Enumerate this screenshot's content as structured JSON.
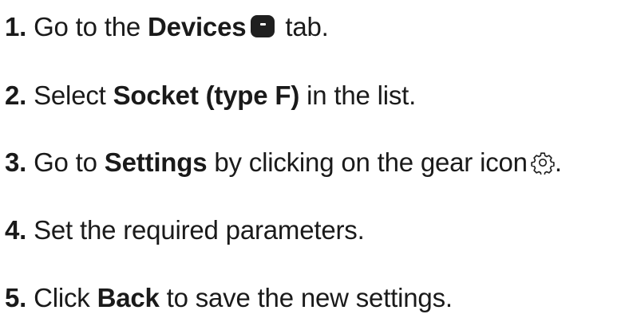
{
  "steps": [
    {
      "number": "1.",
      "before": " Go to the ",
      "bold": "Devices",
      "icon": "devices-icon",
      "after": " tab."
    },
    {
      "number": "2.",
      "before": " Select ",
      "bold": "Socket (type F)",
      "after": " in the list."
    },
    {
      "number": "3.",
      "before": " Go to ",
      "bold": "Settings",
      "after": " by clicking on the gear icon",
      "icon": "gear-icon",
      "end": "."
    },
    {
      "number": "4.",
      "text": " Set the required parameters."
    },
    {
      "number": "5.",
      "before": " Click ",
      "bold": "Back",
      "after": " to save the new settings."
    }
  ],
  "colors": {
    "text": "#1a1a1a",
    "icon": "#1f1f1f"
  }
}
